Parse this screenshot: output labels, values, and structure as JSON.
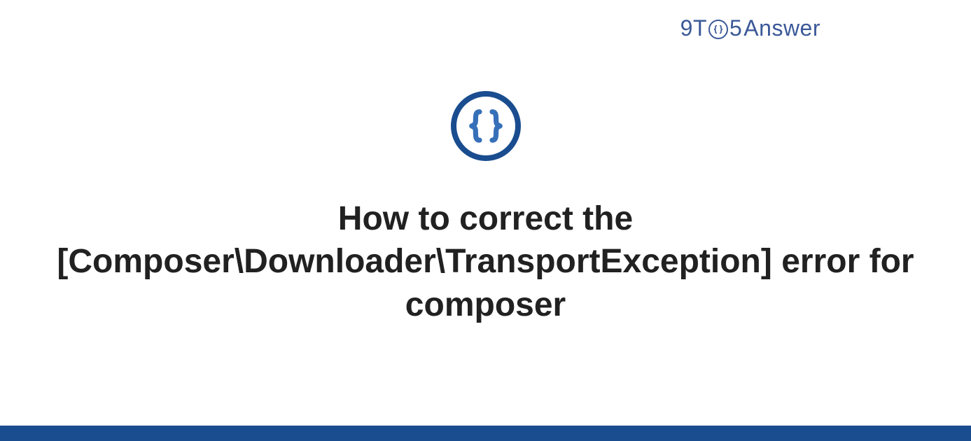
{
  "logo": {
    "nine": "9",
    "t": "T",
    "five": "5",
    "answer": "Answer"
  },
  "title": "How to correct the [Composer\\Downloader\\TransportException] error for composer",
  "colors": {
    "brand": "#3b5998",
    "iconRing": "#1a4d8f",
    "text": "#212121"
  }
}
